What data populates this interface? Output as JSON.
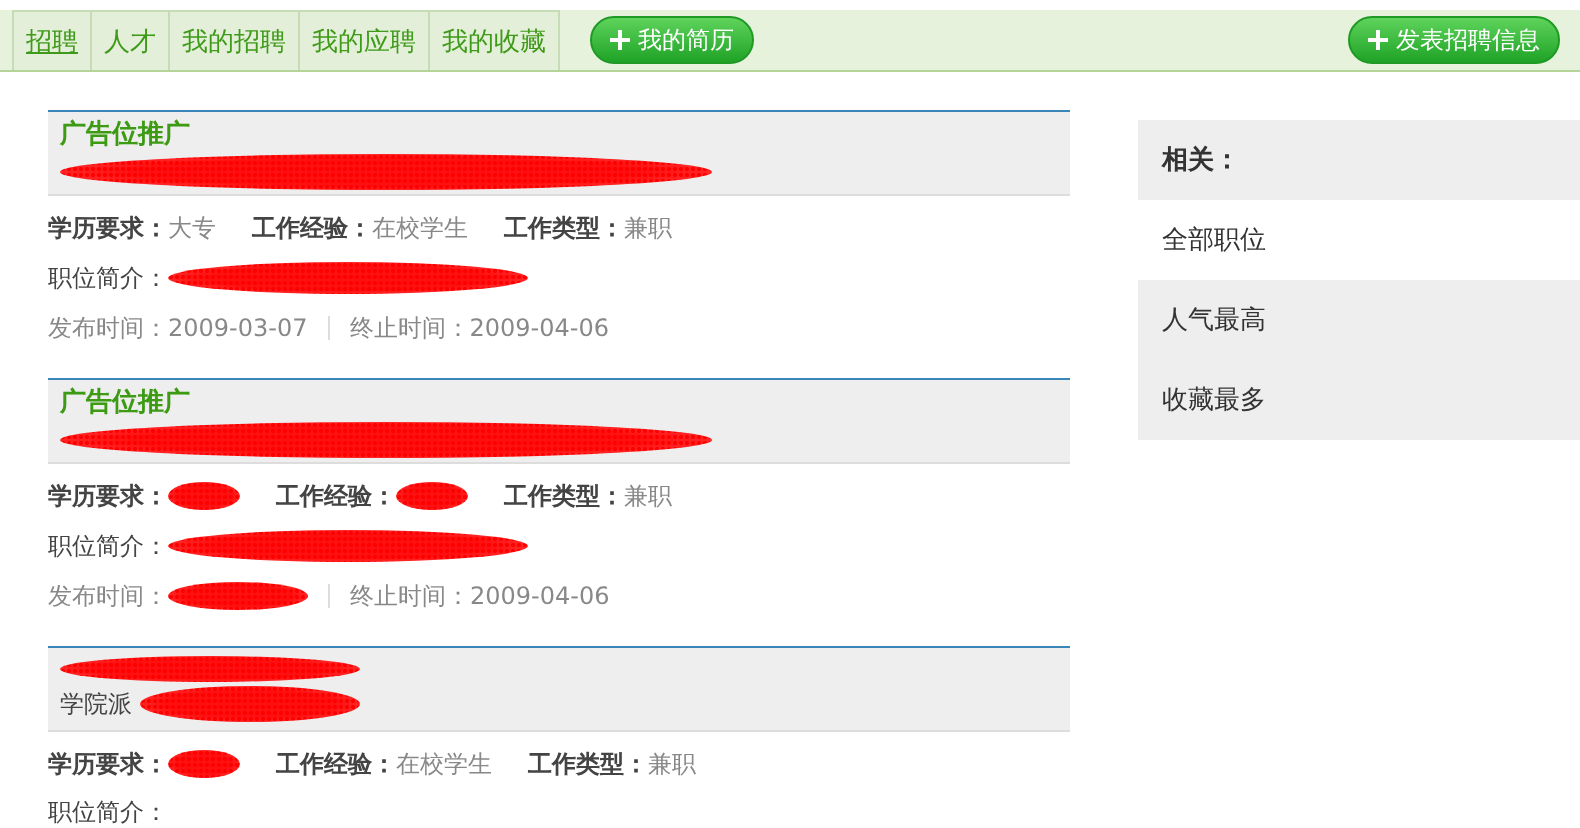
{
  "tabs": [
    {
      "label": "招聘",
      "selected": true
    },
    {
      "label": "人才",
      "selected": false
    },
    {
      "label": "我的招聘",
      "selected": false
    },
    {
      "label": "我的应聘",
      "selected": false
    },
    {
      "label": "我的收藏",
      "selected": false
    }
  ],
  "resume_button": {
    "label": "我的简历"
  },
  "post_button": {
    "label": "发表招聘信息"
  },
  "jobs": [
    {
      "title": "广告位推广",
      "title_redacted": false,
      "line_redacted": true,
      "meta": [
        {
          "label": "学历要求：",
          "value": "大专",
          "redacted": false
        },
        {
          "label": "工作经验：",
          "value": "在校学生",
          "redacted": false
        },
        {
          "label": "工作类型：",
          "value": "兼职",
          "redacted": false
        }
      ],
      "intro_label": "职位简介：",
      "intro_redacted": true,
      "dates": [
        {
          "label": "发布时间：",
          "value": "2009-03-07",
          "redacted": false
        },
        {
          "label": "终止时间：",
          "value": "2009-04-06",
          "redacted": false
        }
      ]
    },
    {
      "title": "广告位推广",
      "title_redacted": false,
      "line_redacted": true,
      "meta": [
        {
          "label": "学历要求：",
          "redacted": true
        },
        {
          "label": "工作经验：",
          "redacted": true
        },
        {
          "label": "工作类型：",
          "value": "兼职",
          "redacted": false
        }
      ],
      "intro_label": "职位简介：",
      "intro_redacted": true,
      "dates": [
        {
          "label": "发布时间：",
          "redacted": true
        },
        {
          "label": "终止时间：",
          "value": "2009-04-06",
          "redacted": false
        }
      ]
    },
    {
      "title_redacted": true,
      "line_redacted": true,
      "subtitle": "学院派",
      "meta": [
        {
          "label": "学历要求：",
          "redacted": true
        },
        {
          "label": "工作经验：",
          "value": "在校学生",
          "redacted": false
        },
        {
          "label": "工作类型：",
          "value": "兼职",
          "redacted": false
        }
      ],
      "intro_label": "职位简介：",
      "intro_redacted": false
    }
  ],
  "related": {
    "heading": "相关：",
    "items": [
      {
        "label": "全部职位",
        "selected": true
      },
      {
        "label": "人气最高",
        "selected": false
      },
      {
        "label": "收藏最多",
        "selected": false
      }
    ]
  }
}
